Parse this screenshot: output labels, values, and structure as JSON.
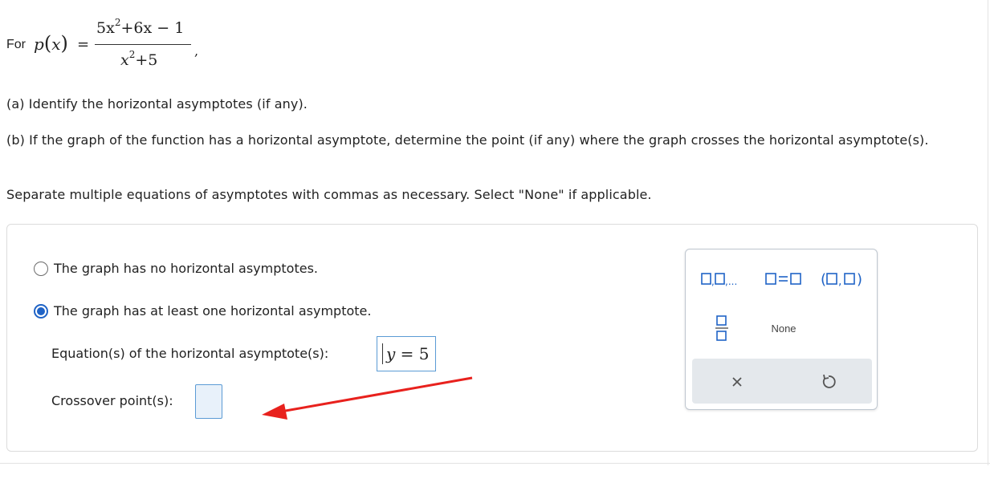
{
  "question": {
    "for_label": "For",
    "function_name": "p",
    "variable": "x",
    "numerator": {
      "t1": "5x",
      "t1_exp": "2",
      "t2": "+6x",
      "t3": "− 1"
    },
    "denominator": {
      "base": "x",
      "exp": "2",
      "rest": "+5"
    },
    "part_a": "(a) Identify the horizontal asymptotes (if any).",
    "part_b": "(b) If the graph of the function has a horizontal asymptote, determine the point (if any) where the graph crosses the horizontal asymptote(s).",
    "instructions": "Separate multiple equations of asymptotes with commas as necessary. Select \"None\" if applicable."
  },
  "answer": {
    "option_none": "The graph has no horizontal asymptotes.",
    "option_some": "The graph has at least one horizontal asymptote.",
    "selected_option": "some",
    "equation_label": "Equation(s) of the horizontal asymptote(s):",
    "equation_value": {
      "var": "y",
      "eq": "=",
      "num": "5"
    },
    "crossover_label": "Crossover point(s):",
    "crossover_value": ""
  },
  "palette": {
    "none_label": "None",
    "buttons": [
      "list-icon",
      "equation-icon",
      "ordered-pair-icon",
      "fraction-icon",
      "none",
      "clear-icon",
      "undo-icon"
    ]
  },
  "colors": {
    "accent": "#1f63c6",
    "input_border": "#5b9bd5",
    "annotation_arrow": "#e8211d",
    "palette_footer": "#e4e8ec"
  }
}
